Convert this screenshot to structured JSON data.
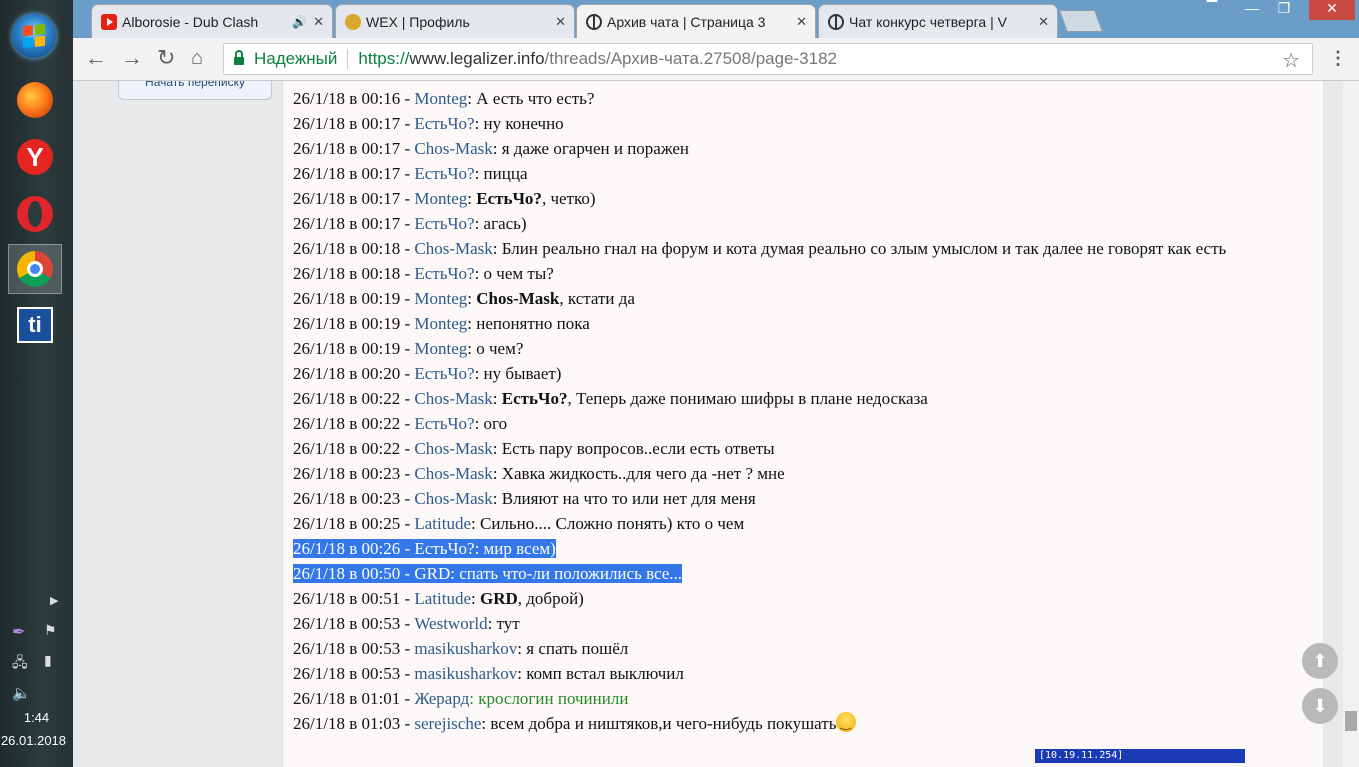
{
  "taskbar": {
    "apps": [
      {
        "name": "firefox"
      },
      {
        "name": "yandex",
        "glyph": "Y"
      },
      {
        "name": "opera"
      },
      {
        "name": "chrome"
      },
      {
        "name": "ti",
        "glyph": "ti"
      }
    ],
    "time": "1:44",
    "date": "26.01.2018"
  },
  "browser": {
    "tabs": [
      {
        "title": "Alborosie - Dub Clash",
        "icon": "youtube-icon"
      },
      {
        "title": "WEX | Профиль",
        "icon": "bitcoin-icon"
      },
      {
        "title": "Архив чата | Страница 3",
        "icon": "peace-icon",
        "active": true
      },
      {
        "title": "Чат конкурс четверга | V",
        "icon": "peace-icon"
      }
    ],
    "close_glyph": "✕",
    "secure_label": "Надежный",
    "url_proto": "https://",
    "url_host": "www.legalizer.info",
    "url_path": "/threads/Архив-чата.27508/page-3182"
  },
  "page": {
    "sidebar_button": "Начать переписку",
    "messages": [
      {
        "time": "26/1/18 в 00:16 - ",
        "user": "Monteg",
        "text": ": А есть что есть?"
      },
      {
        "time": "26/1/18 в 00:17 - ",
        "user": "ЕстьЧо?",
        "text": ": ну конечно"
      },
      {
        "time": "26/1/18 в 00:17 - ",
        "user": "Chos-Mask",
        "text": ": я даже огарчен и поражен"
      },
      {
        "time": "26/1/18 в 00:17 - ",
        "user": "ЕстьЧо?",
        "text": ": пицца"
      },
      {
        "time": "26/1/18 в 00:17 - ",
        "user": "Monteg",
        "text": ": ",
        "bold": "ЕстьЧо?",
        "rest": ", четко)"
      },
      {
        "time": "26/1/18 в 00:17 - ",
        "user": "ЕстьЧо?",
        "text": ": агась)"
      },
      {
        "time": "26/1/18 в 00:18 - ",
        "user": "Chos-Mask",
        "text": ": Блин реально гнал на форум и кота думая реально со злым умыслом и так далее не говорят как есть"
      },
      {
        "time": "26/1/18 в 00:18 - ",
        "user": "ЕстьЧо?",
        "text": ": о чем ты?"
      },
      {
        "time": "26/1/18 в 00:19 - ",
        "user": "Monteg",
        "text": ": ",
        "bold": "Chos-Mask",
        "rest": ", кстати да"
      },
      {
        "time": "26/1/18 в 00:19 - ",
        "user": "Monteg",
        "text": ": непонятно пока"
      },
      {
        "time": "26/1/18 в 00:19 - ",
        "user": "Monteg",
        "text": ": о чем?"
      },
      {
        "time": "26/1/18 в 00:20 - ",
        "user": "ЕстьЧо?",
        "text": ": ну бывает)"
      },
      {
        "time": "26/1/18 в 00:22 - ",
        "user": "Chos-Mask",
        "text": ": ",
        "bold": "ЕстьЧо?",
        "rest": ", Теперь даже понимаю шифры в плане недосказа"
      },
      {
        "time": "26/1/18 в 00:22 - ",
        "user": "ЕстьЧо?",
        "text": ": ого"
      },
      {
        "time": "26/1/18 в 00:22 - ",
        "user": "Chos-Mask",
        "text": ": Есть пару вопросов..если есть ответы"
      },
      {
        "time": "26/1/18 в 00:23 - ",
        "user": "Chos-Mask",
        "text": ": Хавка жидкость..для чего да -нет ? мне"
      },
      {
        "time": "26/1/18 в 00:23 - ",
        "user": "Chos-Mask",
        "text": ": Влияют на что то или нет для меня"
      },
      {
        "time": "26/1/18 в 00:25 - ",
        "user": "Latitude",
        "text": ": Сильно.... Сложно понять) кто о чем"
      },
      {
        "time": "26/1/18 в 00:26 - ",
        "user": "ЕстьЧо?",
        "text": ": мир всем)",
        "selected": true
      },
      {
        "time": "26/1/18 в 00:50 - ",
        "user": "GRD",
        "text": ": спать что-ли положились все...",
        "selected": true
      },
      {
        "time": "26/1/18 в 00:51 - ",
        "user": "Latitude",
        "text": ": ",
        "bold": "GRD",
        "rest": ", доброй)"
      },
      {
        "time": "26/1/18 в 00:53 - ",
        "user": "Westworld",
        "text": ": тут"
      },
      {
        "time": "26/1/18 в 00:53 - ",
        "user": "masikusharkov",
        "text": ": я спать пошёл"
      },
      {
        "time": "26/1/18 в 00:53 - ",
        "user": "masikusharkov",
        "text": ": комп встал выключил"
      },
      {
        "time": "26/1/18 в 01:01 - ",
        "user": "Жерард",
        "text": ": кpослогин починили",
        "green": true
      },
      {
        "time": "26/1/18 в 01:03 - ",
        "user": "serejische",
        "text": ": всем добра и ништяков,и чего-нибудь покушать",
        "smiley": true
      }
    ],
    "status_ip": "[10.19.11.254]"
  }
}
